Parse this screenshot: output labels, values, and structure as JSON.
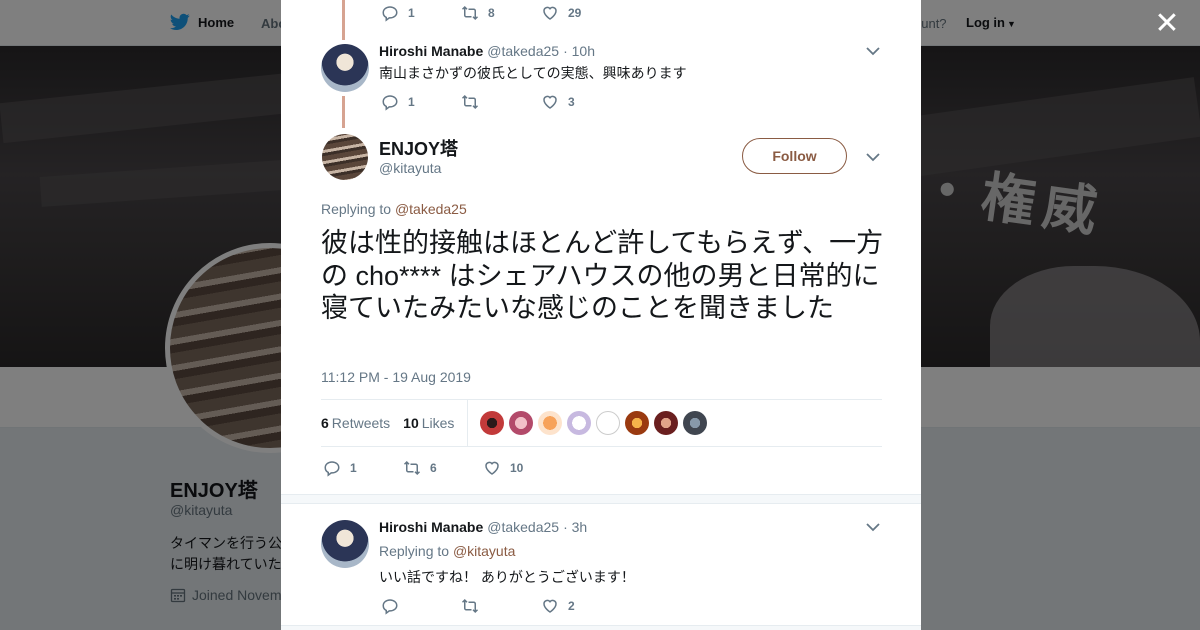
{
  "topbar": {
    "home_label": "Home",
    "about_label": "Abo",
    "account_prompt": "ount?",
    "login_label": "Log in"
  },
  "banner": {
    "sign_text": "・権威"
  },
  "profile": {
    "name": "ENJOY塔",
    "handle": "@kitayuta",
    "bio_line1": "タイマンを行う公",
    "bio_line2": "に明け暮れていた",
    "joined": "Joined Novem"
  },
  "colors": {
    "link": "#8a5b43",
    "twitter_blue": "#1da1f2",
    "thread_line": "#d6a391"
  },
  "tweets": {
    "top_actions": {
      "replies": "1",
      "retweets": "8",
      "likes": "29"
    },
    "parent": {
      "name": "Hiroshi Manabe",
      "handle": "@takeda25",
      "time": "· 10h",
      "text": "南山まさかずの彼氏としての実態、興味あります",
      "replies": "1",
      "retweets": "",
      "likes": "3"
    },
    "main": {
      "name": "ENJOY塔",
      "handle": "@kitayuta",
      "follow_label": "Follow",
      "replying_prefix": "Replying to",
      "replying_to": "@takeda25",
      "text": "彼は性的接触はほとんど許してもらえず、一方の cho**** はシェアハウスの他の男と日常的に寝ていたみたいな感じのことを聞きました",
      "date": "11:12 PM - 19 Aug 2019",
      "retweets_count": "6",
      "retweets_label": "Retweets",
      "likes_count": "10",
      "likes_label": "Likes",
      "replies": "1",
      "retweets": "6",
      "likes": "10"
    },
    "reply": {
      "name": "Hiroshi Manabe",
      "handle": "@takeda25",
      "time": "· 3h",
      "replying_prefix": "Replying to",
      "replying_to": "@kitayuta",
      "text": "いい話ですね！ ありがとうございます！",
      "replies": "",
      "retweets": "",
      "likes": "2"
    }
  },
  "icons": [
    "twitter-bird-icon",
    "close-icon",
    "reply-icon",
    "retweet-icon",
    "like-icon",
    "chevron-down-icon",
    "calendar-icon"
  ]
}
